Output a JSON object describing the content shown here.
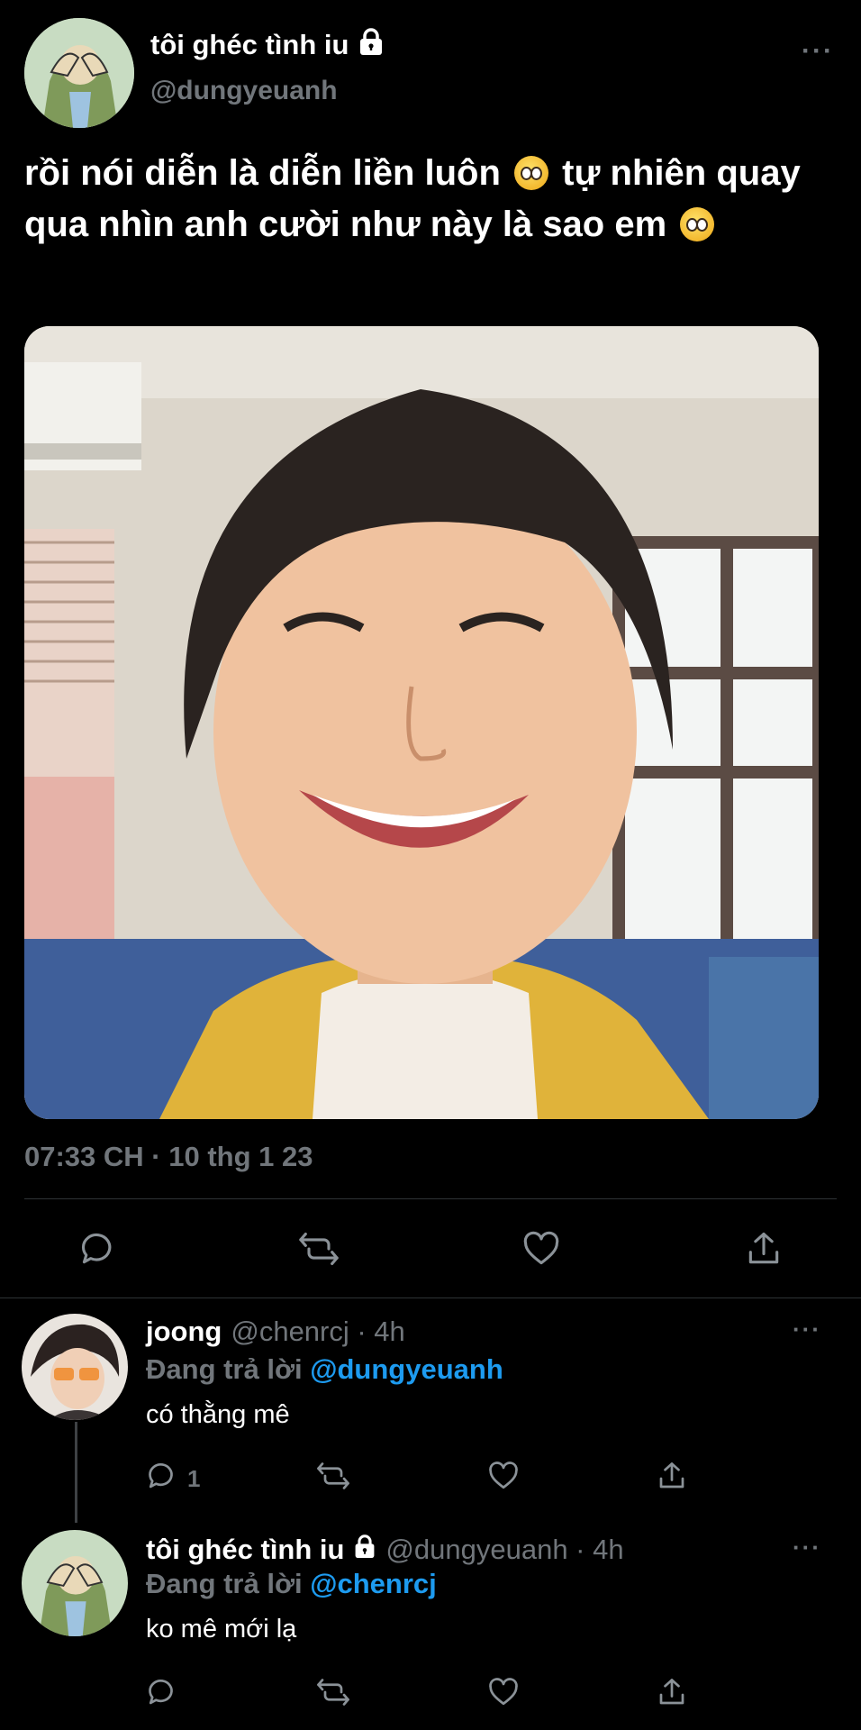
{
  "main_tweet": {
    "display_name": "tôi ghéc tình iu",
    "handle": "@dungyeuanh",
    "text_part1": "rồi nói diễn là diễn liền luôn",
    "text_part2": "tự nhiên quay qua nhìn anh cười như này là sao em",
    "timestamp": "07:33 CH · 10 thg 1 23",
    "more_label": "···"
  },
  "icons": {
    "reply": "reply-icon",
    "retweet": "retweet-icon",
    "like": "heart-icon",
    "share": "share-icon",
    "lock": "lock-icon",
    "emoji": "pleading-face-emoji"
  },
  "replies": [
    {
      "display_name": "joong",
      "handle_time": "@chenrcj · 4h",
      "replying_prefix": "Đang trả lời",
      "replying_to": "@dungyeuanh",
      "text": "có thằng mê",
      "reply_count": "1",
      "more_label": "···"
    },
    {
      "display_name": "tôi ghéc tình iu",
      "handle_time": "@dungyeuanh · 4h",
      "replying_prefix": "Đang trả lời",
      "replying_to": "@chenrcj",
      "text": "ko mê mới lạ",
      "reply_count": "",
      "more_label": "···"
    }
  ],
  "colors": {
    "background": "#000000",
    "text": "#ffffff",
    "secondary": "#71767b",
    "accent": "#1d9bf0"
  }
}
